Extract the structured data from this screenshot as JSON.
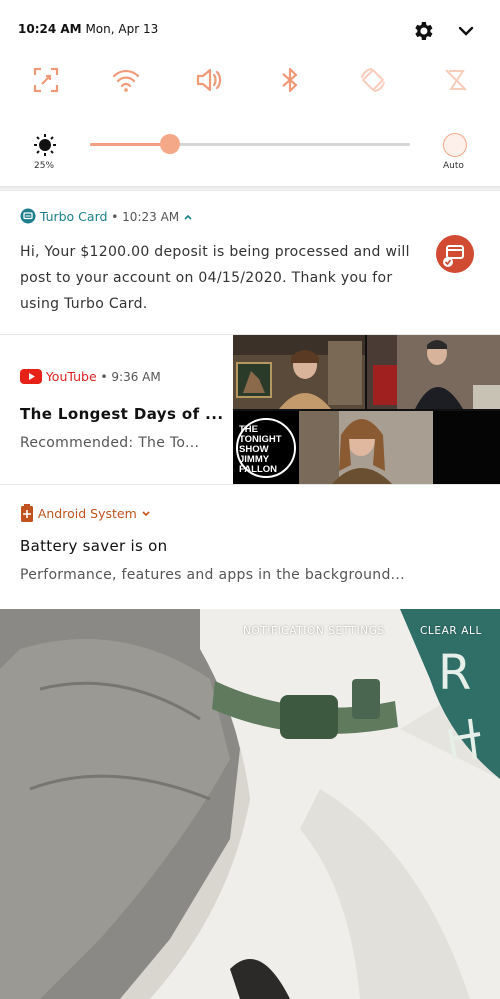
{
  "status_bar": {
    "time": "10:24 AM",
    "date": "Mon, Apr 13"
  },
  "header_icons": [
    "gear-icon",
    "chevron-down-icon"
  ],
  "quick_tiles": [
    {
      "name": "screen-capture-icon",
      "active": true
    },
    {
      "name": "wifi-icon",
      "active": true
    },
    {
      "name": "sound-icon",
      "active": true
    },
    {
      "name": "bluetooth-icon",
      "active": true
    },
    {
      "name": "auto-rotate-icon",
      "active": false
    },
    {
      "name": "do-not-disturb-icon",
      "active": false
    }
  ],
  "brightness": {
    "percent_label": "25%",
    "level": 0.25,
    "auto_label": "Auto"
  },
  "notifications": {
    "turbo": {
      "app": "Turbo Card",
      "separator": "•",
      "time": "10:23 AM",
      "message": "Hi, Your $1200.00 deposit is being processed and will post to your account on 04/15/2020. Thank you for using Turbo Card."
    },
    "youtube": {
      "app": "YouTube",
      "separator": "•",
      "time": "9:36 AM",
      "title": "The Longest Days of ...",
      "subtitle": "Recommended: The To...",
      "thumbnail_text": "THE TONIGHT SHOW JIMMY FALLON"
    },
    "android": {
      "app": "Android System",
      "title": "Battery saver is on",
      "subtitle": "Performance, features and apps in the background..."
    }
  },
  "actions": {
    "settings": "NOTIFICATION SETTINGS",
    "clear": "CLEAR ALL"
  },
  "colors": {
    "accent": "#f09a7a",
    "turbo": "#1d7f8c",
    "youtube": "#e62117",
    "android": "#c0531f"
  }
}
